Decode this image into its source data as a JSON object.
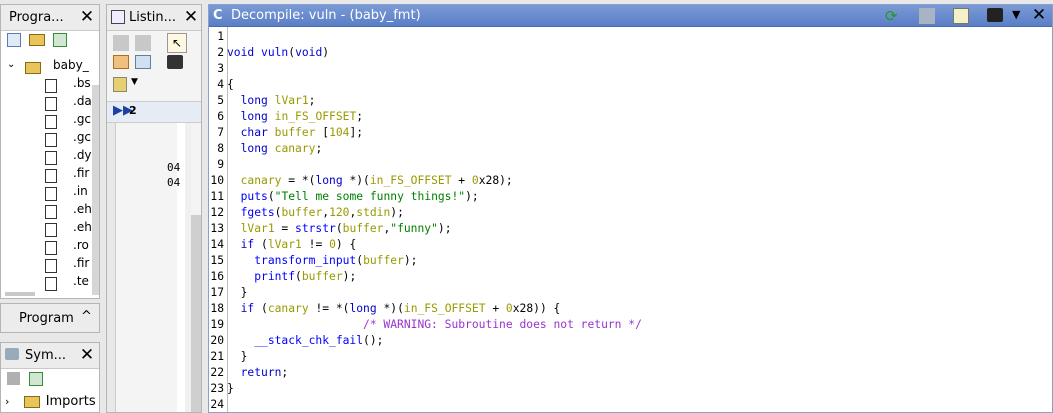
{
  "program_panel": {
    "title": "Progra...",
    "root_label": "baby_",
    "items": [
      ".bs",
      ".da",
      ".gc",
      ".gc",
      ".dy",
      ".fir",
      ".in",
      ".eh",
      ".eh",
      ".ro",
      ".fir",
      ".te"
    ],
    "tab_label": "Program"
  },
  "symbol_panel": {
    "title": "Sym...",
    "imports_label": "Imports"
  },
  "listing_panel": {
    "title": "Listin...",
    "addr1": "04",
    "addr2": "04",
    "arrow_label": "2"
  },
  "decompile_panel": {
    "title": "Decompile: vuln -  (baby_fmt)"
  },
  "code_lines": [
    {
      "n": "1",
      "t": ""
    },
    {
      "n": "2",
      "t": "void vuln(void)"
    },
    {
      "n": "3",
      "t": ""
    },
    {
      "n": "4",
      "t": "{"
    },
    {
      "n": "5",
      "t": "  long lVar1;"
    },
    {
      "n": "6",
      "t": "  long in_FS_OFFSET;"
    },
    {
      "n": "7",
      "t": "  char buffer [104];"
    },
    {
      "n": "8",
      "t": "  long canary;"
    },
    {
      "n": "9",
      "t": ""
    },
    {
      "n": "10",
      "t": "  canary = *(long *)(in_FS_OFFSET + 0x28);"
    },
    {
      "n": "11",
      "t": "  puts(\"Tell me some funny things!\");"
    },
    {
      "n": "12",
      "t": "  fgets(buffer,120,stdin);"
    },
    {
      "n": "13",
      "t": "  lVar1 = strstr(buffer,\"funny\");"
    },
    {
      "n": "14",
      "t": "  if (lVar1 != 0) {"
    },
    {
      "n": "15",
      "t": "    transform_input(buffer);"
    },
    {
      "n": "16",
      "t": "    printf(buffer);"
    },
    {
      "n": "17",
      "t": "  }"
    },
    {
      "n": "18",
      "t": "  if (canary != *(long *)(in_FS_OFFSET + 0x28)) {"
    },
    {
      "n": "19",
      "t": "                    /* WARNING: Subroutine does not return */"
    },
    {
      "n": "20",
      "t": "    __stack_chk_fail();"
    },
    {
      "n": "21",
      "t": "  }"
    },
    {
      "n": "22",
      "t": "  return;"
    },
    {
      "n": "23",
      "t": "}"
    },
    {
      "n": "24",
      "t": ""
    }
  ]
}
